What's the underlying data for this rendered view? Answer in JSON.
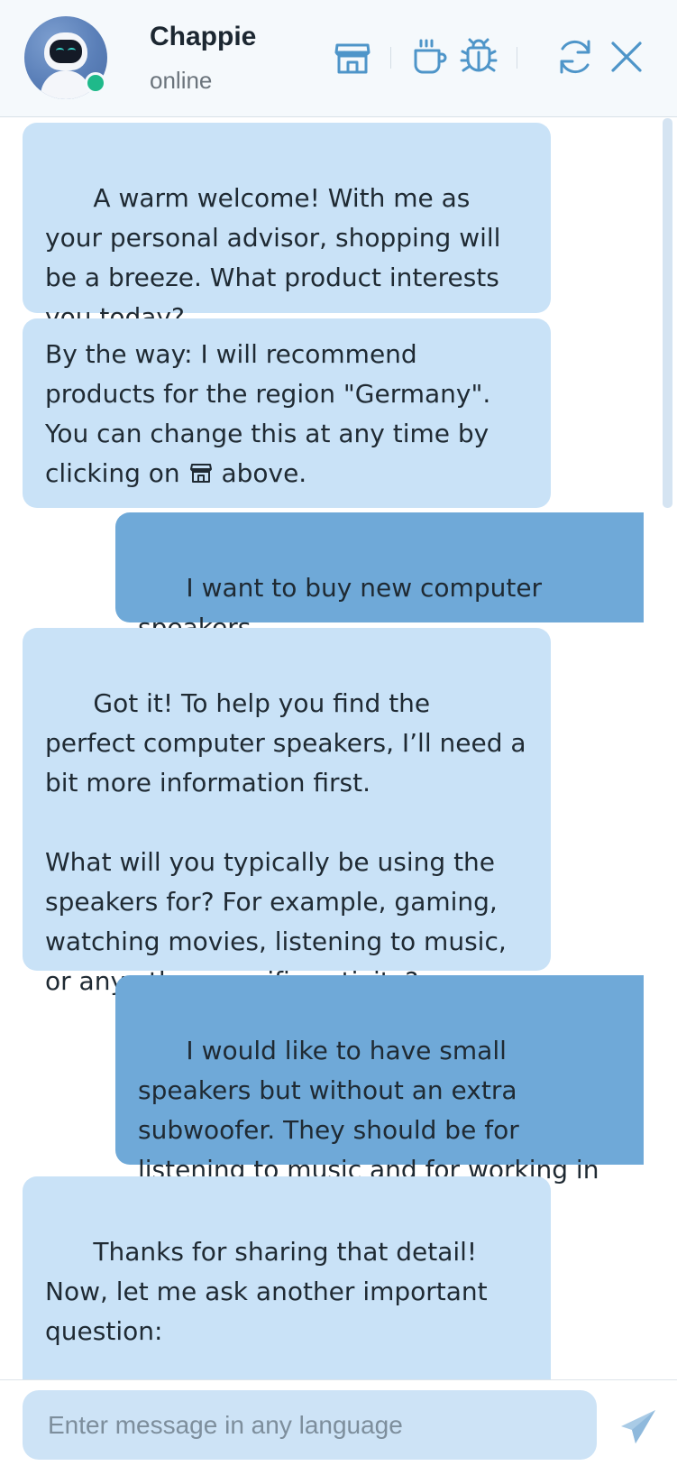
{
  "header": {
    "bot_name": "Chappie",
    "status": "online",
    "status_color": "#1fb98a",
    "icons": [
      "store-icon",
      "coffee-icon",
      "bug-icon",
      "refresh-icon",
      "close-icon"
    ],
    "icon_color": "#4e95c9"
  },
  "messages": [
    {
      "role": "bot",
      "text": "A warm welcome! With me as your personal advisor, shopping will be a breeze. What product interests you today?"
    },
    {
      "role": "bot",
      "text_before": "By the way: I will recommend products for the region \"Germany\". You can change this at any time by clicking on ",
      "inline_icon": "store-icon",
      "text_after": " above."
    },
    {
      "role": "user",
      "text": "I want to buy new computer speakers."
    },
    {
      "role": "bot",
      "text": "Got it! To help you find the perfect computer speakers, I’ll need a bit more information first.\n\nWhat will you typically be using the speakers for? For example, gaming, watching movies, listening to music, or any other specific activity?"
    },
    {
      "role": "user",
      "text": "I would like to have small speakers but without an extra subwoofer. They should be for listening to music and for working in teams Calls"
    },
    {
      "role": "bot",
      "text": "Thanks for sharing that detail! Now, let me ask another important question:\n\nWhat’s your budget for these"
    }
  ],
  "input": {
    "placeholder": "Enter message in any language",
    "value": ""
  },
  "colors": {
    "bot_bubble": "#c9e2f7",
    "user_bubble": "#6fa9d8",
    "header_bg": "#f5f9fc"
  }
}
